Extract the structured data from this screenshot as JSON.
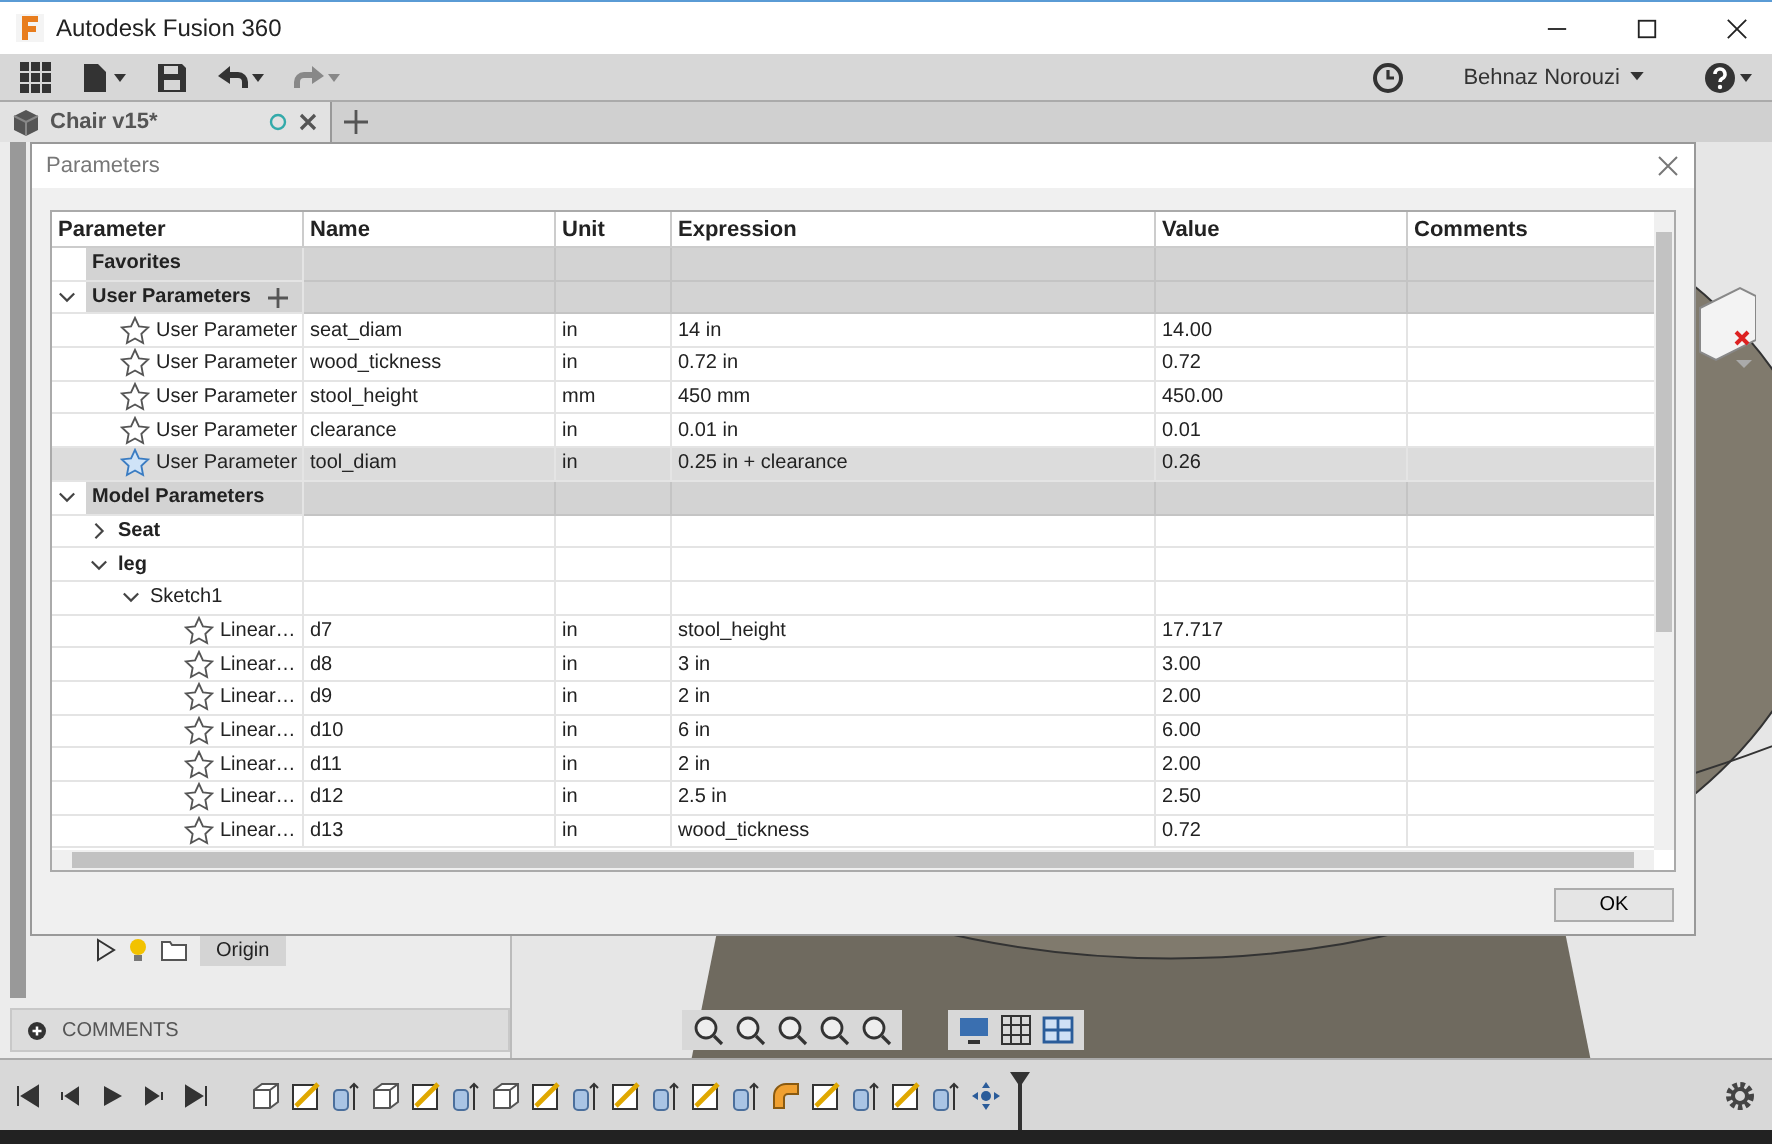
{
  "window": {
    "title": "Autodesk Fusion 360"
  },
  "toolbar": {
    "user_name": "Behnaz Norouzi"
  },
  "document_tab": {
    "title": "Chair v15*",
    "selected": true
  },
  "browser": {
    "item": {
      "label": "Origin"
    },
    "comments_label": "COMMENTS"
  },
  "dialog": {
    "title": "Parameters",
    "ok_label": "OK",
    "columns": [
      "Parameter",
      "Name",
      "Unit",
      "Expression",
      "Value",
      "Comments"
    ],
    "rows": [
      {
        "kind": "group",
        "label": "Favorites"
      },
      {
        "kind": "group",
        "label": "User Parameters",
        "expanded": true,
        "can_add": true,
        "children": [
          {
            "kind": "param",
            "parameter": "User Parameter",
            "name": "seat_diam",
            "unit": "in",
            "expression": "14 in",
            "value": "14.00",
            "selected": false
          },
          {
            "kind": "param",
            "parameter": "User Parameter",
            "name": "wood_tickness",
            "unit": "in",
            "expression": "0.72 in",
            "value": "0.72",
            "selected": false
          },
          {
            "kind": "param",
            "parameter": "User Parameter",
            "name": "stool_height",
            "unit": "mm",
            "expression": "450 mm",
            "value": "450.00",
            "selected": false
          },
          {
            "kind": "param",
            "parameter": "User Parameter",
            "name": "clearance",
            "unit": "in",
            "expression": "0.01 in",
            "value": "0.01",
            "selected": false
          },
          {
            "kind": "param",
            "parameter": "User Parameter",
            "name": "tool_diam",
            "unit": "in",
            "expression": "0.25 in + clearance",
            "value": "0.26",
            "selected": true
          }
        ]
      },
      {
        "kind": "group",
        "label": "Model Parameters",
        "expanded": true,
        "children": [
          {
            "kind": "node",
            "label": "Seat",
            "expanded": false
          },
          {
            "kind": "node",
            "label": "leg",
            "expanded": true,
            "children": [
              {
                "kind": "node",
                "label": "Sketch1",
                "expanded": true,
                "bold": false,
                "children": [
                  {
                    "kind": "param",
                    "parameter": "Linear…",
                    "name": "d7",
                    "unit": "in",
                    "expression": "stool_height",
                    "value": "17.717",
                    "selected": false
                  },
                  {
                    "kind": "param",
                    "parameter": "Linear…",
                    "name": "d8",
                    "unit": "in",
                    "expression": "3 in",
                    "value": "3.00",
                    "selected": false
                  },
                  {
                    "kind": "param",
                    "parameter": "Linear…",
                    "name": "d9",
                    "unit": "in",
                    "expression": "2 in",
                    "value": "2.00",
                    "selected": false
                  },
                  {
                    "kind": "param",
                    "parameter": "Linear…",
                    "name": "d10",
                    "unit": "in",
                    "expression": "6 in",
                    "value": "6.00",
                    "selected": false
                  },
                  {
                    "kind": "param",
                    "parameter": "Linear…",
                    "name": "d11",
                    "unit": "in",
                    "expression": "2 in",
                    "value": "2.00",
                    "selected": false
                  },
                  {
                    "kind": "param",
                    "parameter": "Linear…",
                    "name": "d12",
                    "unit": "in",
                    "expression": "2.5 in",
                    "value": "2.50",
                    "selected": false
                  },
                  {
                    "kind": "param",
                    "parameter": "Linear…",
                    "name": "d13",
                    "unit": "in",
                    "expression": "wood_tickness",
                    "value": "0.72",
                    "selected": false
                  }
                ]
              }
            ]
          }
        ]
      }
    ]
  }
}
